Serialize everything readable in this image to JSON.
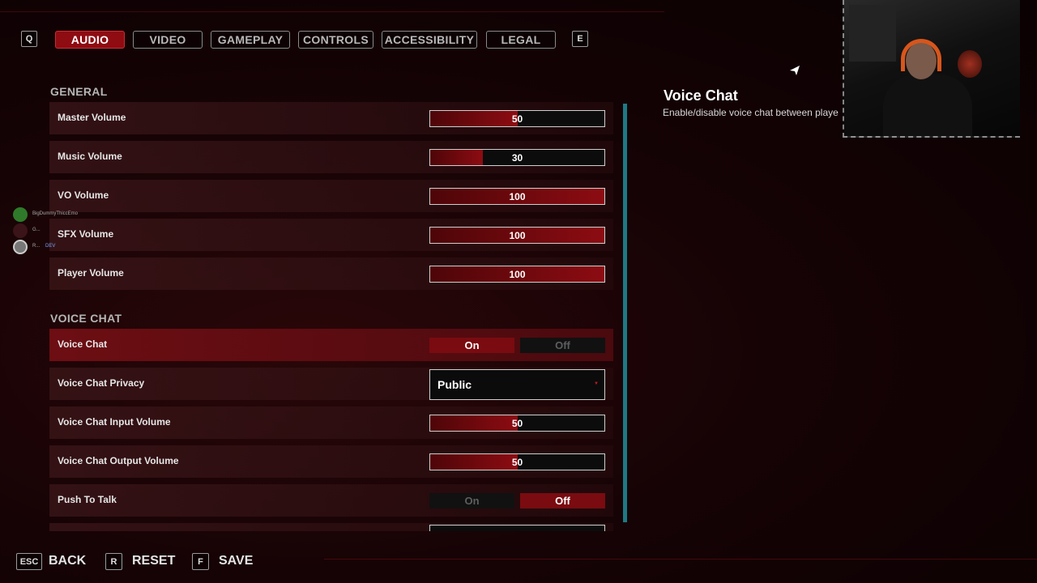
{
  "nav": {
    "prev_key": "Q",
    "next_key": "E",
    "tabs": [
      {
        "label": "AUDIO",
        "active": true
      },
      {
        "label": "VIDEO",
        "active": false
      },
      {
        "label": "GAMEPLAY",
        "active": false
      },
      {
        "label": "CONTROLS",
        "active": false
      },
      {
        "label": "ACCESSIBILITY",
        "active": false
      },
      {
        "label": "LEGAL",
        "active": false
      }
    ]
  },
  "general": {
    "title": "GENERAL",
    "settings": [
      {
        "label": "Master Volume",
        "value": "50",
        "fill_percent": 50
      },
      {
        "label": "Music Volume",
        "value": "30",
        "fill_percent": 30
      },
      {
        "label": "VO Volume",
        "value": "100",
        "fill_percent": 100
      },
      {
        "label": "SFX Volume",
        "value": "100",
        "fill_percent": 100
      },
      {
        "label": "Player Volume",
        "value": "100",
        "fill_percent": 100
      }
    ]
  },
  "voice_chat": {
    "title": "VOICE CHAT",
    "toggle": {
      "label": "Voice Chat",
      "on_label": "On",
      "off_label": "Off",
      "selected": "On"
    },
    "privacy": {
      "label": "Voice Chat Privacy",
      "value": "Public"
    },
    "input_volume": {
      "label": "Voice Chat Input Volume",
      "value": "50",
      "fill_percent": 50
    },
    "output_volume": {
      "label": "Voice Chat Output Volume",
      "value": "50",
      "fill_percent": 50
    },
    "push_to_talk": {
      "label": "Push To Talk",
      "on_label": "On",
      "off_label": "Off",
      "selected": "Off"
    }
  },
  "detail": {
    "title": "Voice Chat",
    "description": "Enable/disable voice chat between playe"
  },
  "overlay_chat": [
    {
      "name": "BigDummyThiccEmo",
      "avatar_color": "#2f7a2a"
    },
    {
      "name": "G...",
      "avatar_color": "#3a1418"
    },
    {
      "name": "R...",
      "badge": "DEV",
      "avatar_color": "#777777"
    }
  ],
  "footer": {
    "back": {
      "key": "ESC",
      "label": "BACK"
    },
    "reset": {
      "key": "R",
      "label": "RESET"
    },
    "save": {
      "key": "F",
      "label": "SAVE"
    }
  },
  "colors": {
    "accent_red": "#8e0c12",
    "scroll_teal": "#1d7a85"
  },
  "icons": [
    "mouse-cursor-icon",
    "chevron-down-icon"
  ]
}
